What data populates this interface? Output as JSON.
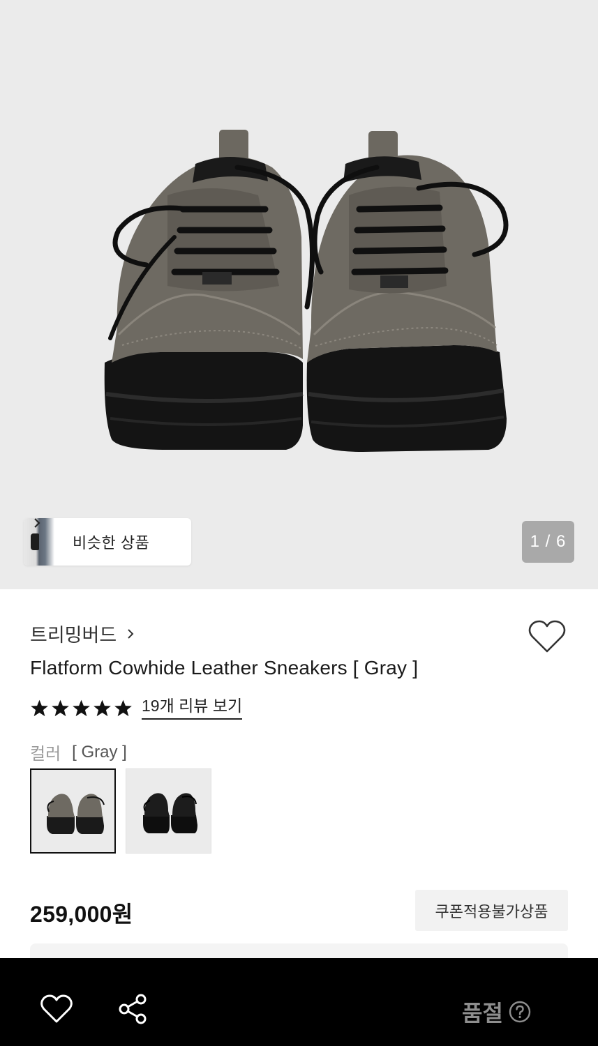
{
  "gallery": {
    "similar_label": "비슷한 상품",
    "counter": "1 / 6"
  },
  "product": {
    "brand": "트리밍버드",
    "title": "Flatform Cowhide Leather Sneakers [ Gray ]",
    "rating_stars": 5,
    "review_link": "19개 리뷰 보기",
    "color_label": "컬러",
    "color_value": "[ Gray ]",
    "color_options": [
      "Gray",
      "Black"
    ],
    "selected_color_index": 0,
    "price": "259,000원",
    "coupon_badge": "쿠폰적용불가상품"
  },
  "bottom_bar": {
    "status": "품절"
  },
  "colors": {
    "background_gallery": "#ebebeb",
    "bottom_bar": "#000000",
    "soldout_text": "#8e8e8e"
  }
}
